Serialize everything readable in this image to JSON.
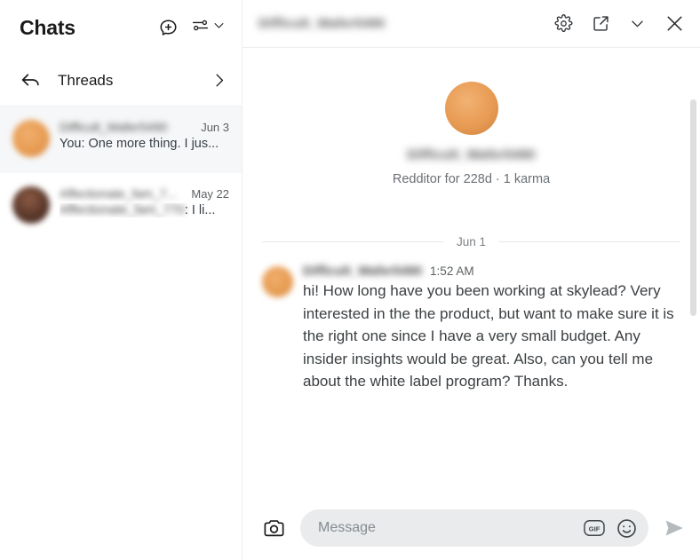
{
  "sidebar": {
    "title": "Chats",
    "new_chat_icon": "new-chat-plus-icon",
    "filter_icon": "filter-sliders-icon",
    "filter_chevron_icon": "chevron-down-icon",
    "threads": {
      "label": "Threads",
      "back_icon": "back-arrow-icon",
      "chevron_icon": "chevron-right-icon"
    },
    "chats": [
      {
        "name": "Difficult_Wafer5490",
        "name_redacted": true,
        "date": "Jun 3",
        "preview_prefix": "You: ",
        "preview": "One more thing. I jus...",
        "avatar_color": "#e79c52",
        "selected": true
      },
      {
        "name": "Affectionate_fam_7...",
        "name_redacted": true,
        "date": "May 22",
        "preview_prefix": "",
        "preview_name": "Affectionate_fam_770",
        "preview": ": I li...",
        "avatar_color": "#5d3a2c",
        "selected": false
      }
    ]
  },
  "main": {
    "header": {
      "title": "Difficult_Wafer5490",
      "title_redacted": true,
      "settings_icon": "gear-icon",
      "open_external_icon": "external-link-icon",
      "collapse_icon": "chevron-down-icon",
      "close_icon": "close-x-icon"
    },
    "profile": {
      "avatar_color": "#e89b53",
      "username": "Difficult_Wafer5490",
      "username_redacted": true,
      "meta": "Redditor for 228d  ·  1 karma"
    },
    "date_divider": "Jun 1",
    "messages": [
      {
        "author": "Difficult_Wafer5490",
        "author_redacted": true,
        "time": "1:52 AM",
        "text": "hi! How long have you been working at skylead? Very interested in the the product, but want to make sure it is the right one since I have a very small budget. Any insider insights would be great. Also, can you tell me about the white label program? Thanks.",
        "avatar_color": "#e79c52"
      }
    ],
    "annotation": {
      "type": "down-arrow",
      "color": "#e01f1f"
    },
    "scrollbar": {
      "color": "#dcdedf"
    }
  },
  "composer": {
    "camera_icon": "camera-icon",
    "placeholder": "Message",
    "value": "",
    "gif_label": "GIF",
    "emoji_icon": "emoji-smiley-icon",
    "send_icon": "send-arrow-icon"
  }
}
